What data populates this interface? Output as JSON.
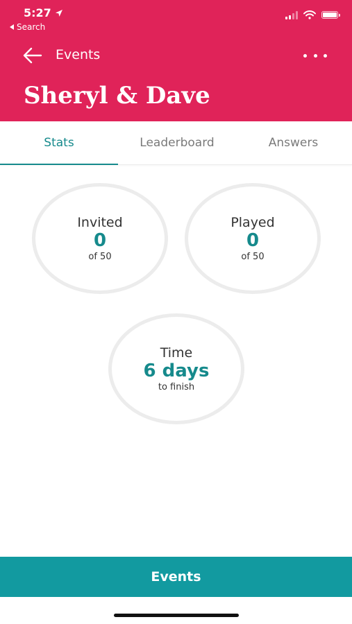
{
  "status_bar": {
    "time": "5:27",
    "back_label": "Search"
  },
  "nav": {
    "back_label": "Events",
    "title": "Sheryl & Dave"
  },
  "tabs": [
    {
      "label": "Stats",
      "active": true
    },
    {
      "label": "Leaderboard",
      "active": false
    },
    {
      "label": "Answers",
      "active": false
    }
  ],
  "stats": {
    "invited": {
      "label": "Invited",
      "value": "0",
      "sub": "of 50"
    },
    "played": {
      "label": "Played",
      "value": "0",
      "sub": "of 50"
    },
    "time": {
      "label": "Time",
      "value": "6 days",
      "sub": "to finish"
    }
  },
  "bottom_bar": {
    "label": "Events"
  },
  "colors": {
    "header": "#e02359",
    "accent": "#168a8c",
    "bottom_bar": "#129aa0"
  }
}
